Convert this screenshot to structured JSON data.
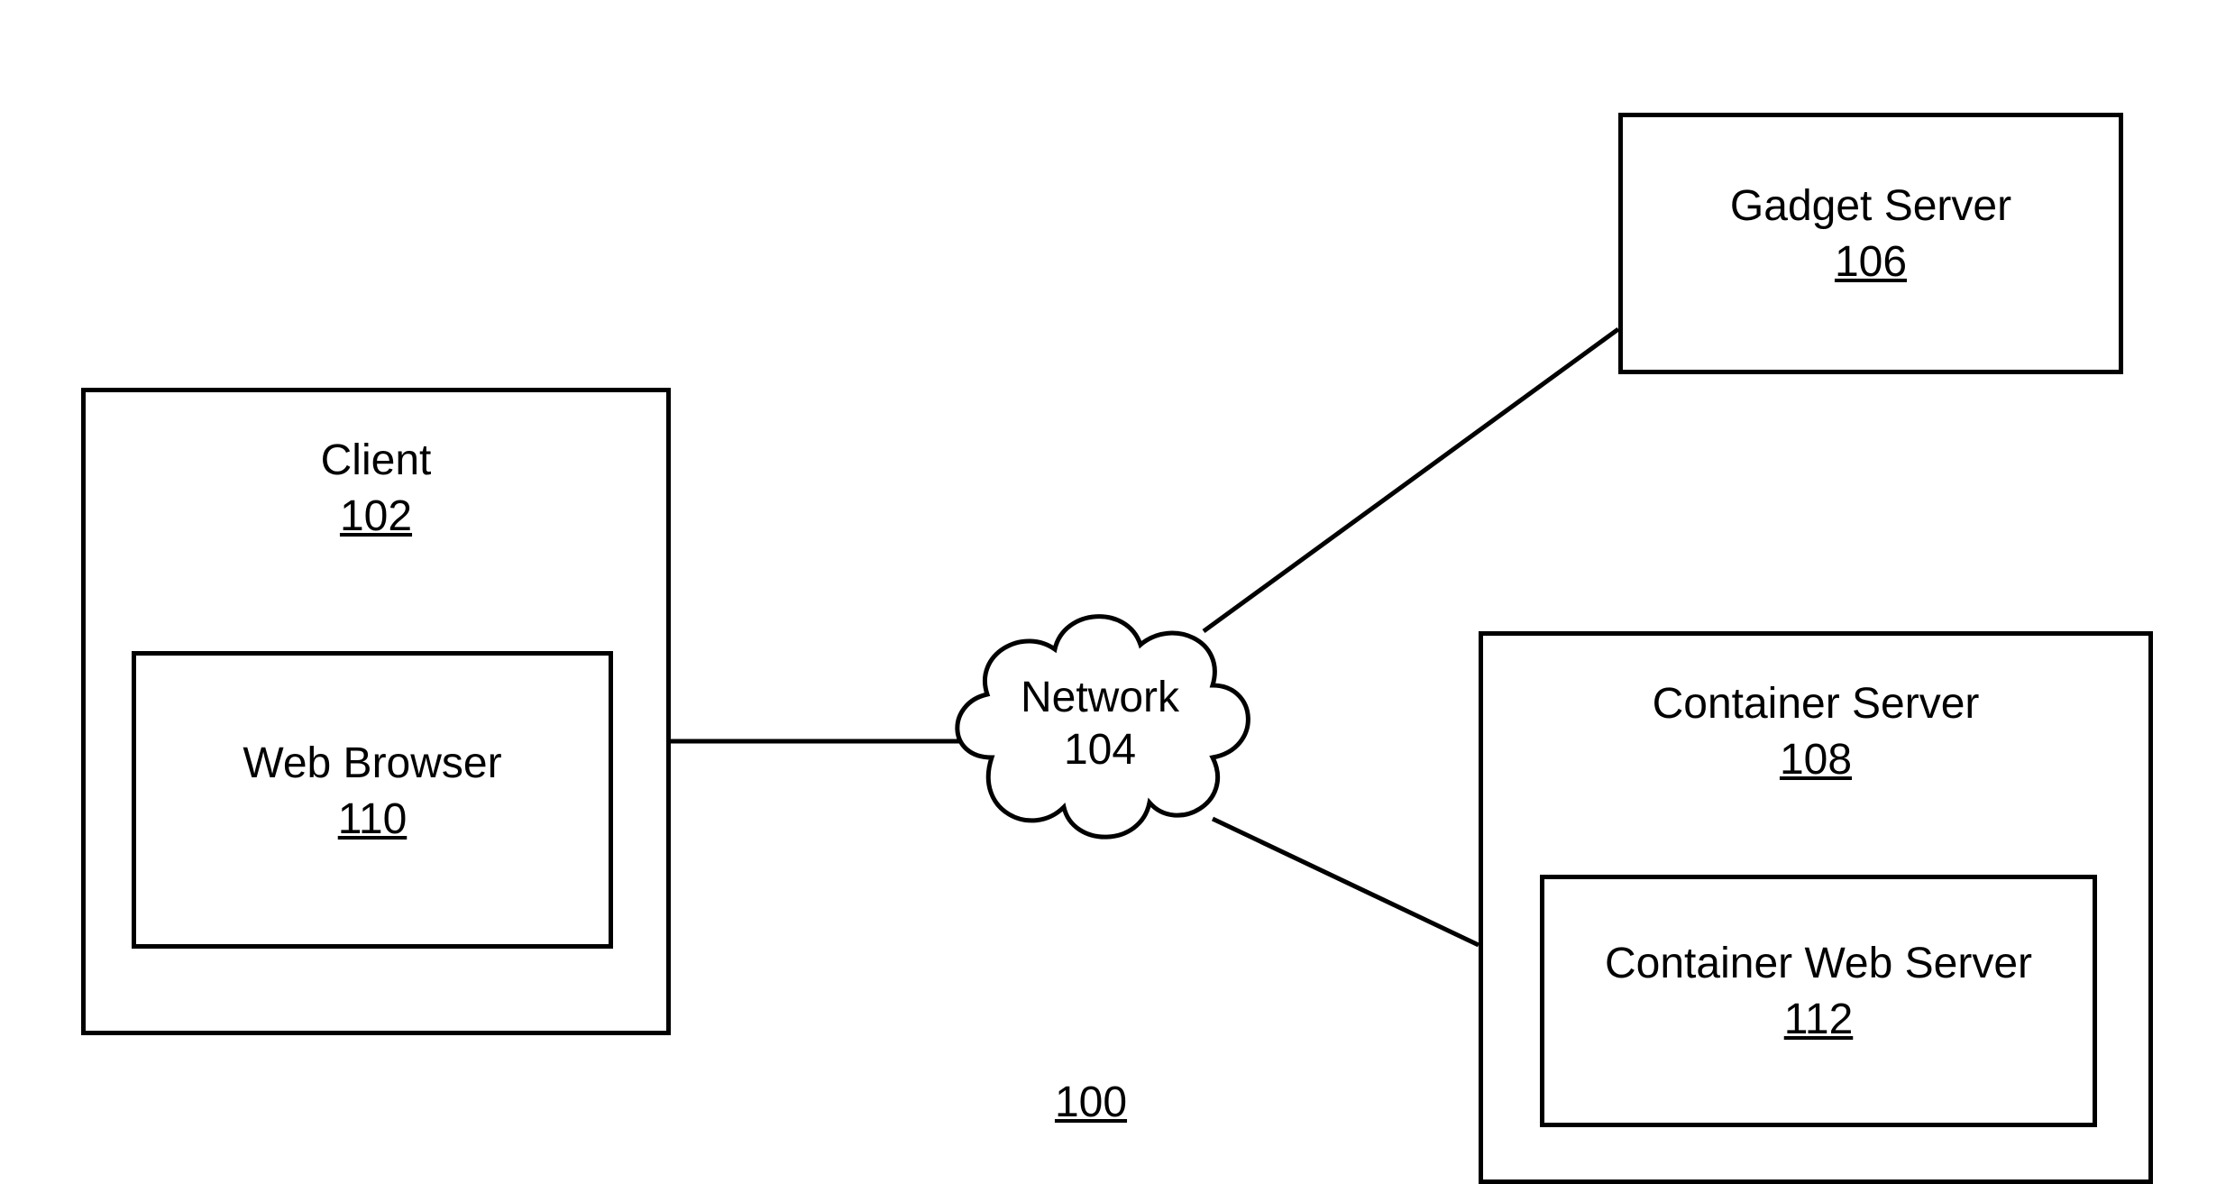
{
  "nodes": {
    "client": {
      "label": "Client",
      "ref": "102"
    },
    "web_browser": {
      "label": "Web Browser",
      "ref": "110"
    },
    "network": {
      "label": "Network",
      "ref": "104"
    },
    "gadget_server": {
      "label": "Gadget Server",
      "ref": "106"
    },
    "container_server": {
      "label": "Container Server",
      "ref": "108"
    },
    "container_web_server": {
      "label": "Container Web Server",
      "ref": "112"
    }
  },
  "figure_ref": "100"
}
